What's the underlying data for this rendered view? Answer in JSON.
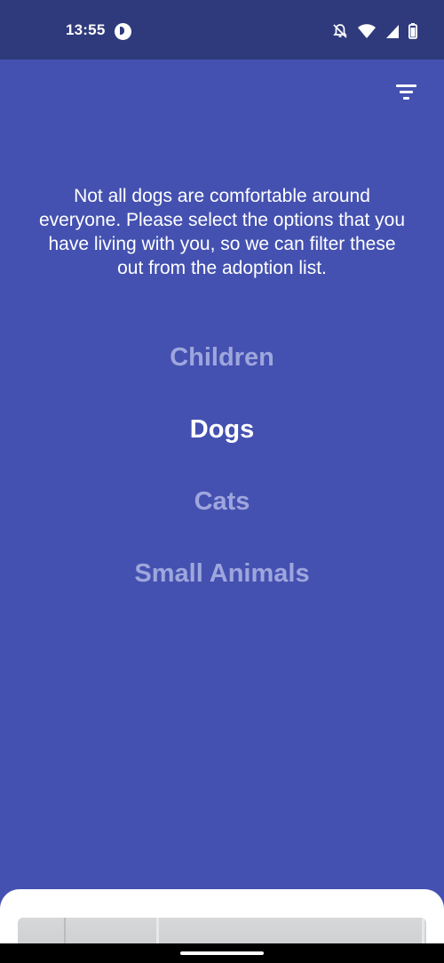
{
  "status_bar": {
    "time": "13:55"
  },
  "header": {
    "filter_icon": "filter-list-icon"
  },
  "intro": {
    "text": "Not all dogs are comfortable around everyone. Please select the options that you have living with you, so we can filter these out from the adoption list."
  },
  "options": [
    {
      "label": "Children",
      "selected": false
    },
    {
      "label": "Dogs",
      "selected": true
    },
    {
      "label": "Cats",
      "selected": false
    },
    {
      "label": "Small Animals",
      "selected": false
    }
  ],
  "colors": {
    "status_bar_bg": "#2f3a7c",
    "main_bg": "#4451b0",
    "option_unselected": "#9ea6dd",
    "option_selected": "#ffffff"
  }
}
